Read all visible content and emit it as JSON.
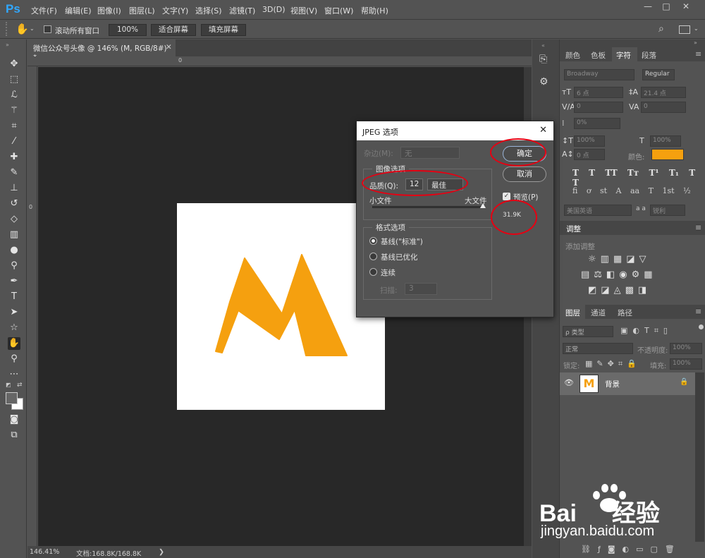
{
  "app": {
    "logo": "Ps"
  },
  "menu": [
    "文件(F)",
    "编辑(E)",
    "图像(I)",
    "图层(L)",
    "文字(Y)",
    "选择(S)",
    "滤镜(T)",
    "3D(D)",
    "视图(V)",
    "窗口(W)",
    "帮助(H)"
  ],
  "window_controls": {
    "minimize": "—",
    "maximize": "□",
    "close": "✕"
  },
  "options_bar": {
    "scroll_all_label": "滚动所有窗口",
    "zoom_btn": "100%",
    "fit_btn": "适合屏幕",
    "fill_btn": "填充屏幕"
  },
  "document_tab": {
    "title": "微信公众号头像 @ 146% (M, RGB/8#) *",
    "close": "✕"
  },
  "rulers": {
    "top_zero": "0",
    "left_zero": "0"
  },
  "status": {
    "zoom": "146.41%",
    "doc": "文档:168.8K/168.8K",
    "arrow": "❯"
  },
  "logo_colors": {
    "accent": "#f5a00f"
  },
  "dialog": {
    "title": "JPEG 选项",
    "close": "✕",
    "matte_label": "杂边(M):",
    "matte_value": "无",
    "image_options": "图像选项",
    "quality_label": "品质(Q):",
    "quality_value": "12",
    "quality_preset": "最佳",
    "small_file": "小文件",
    "large_file": "大文件",
    "format_options": "格式选项",
    "baseline_standard": "基线(\"标准\")",
    "baseline_optimized": "基线已优化",
    "progressive": "连续",
    "scans_label": "扫描:",
    "scans_value": "3",
    "ok": "确定",
    "cancel": "取消",
    "preview_label": "预览(P)",
    "file_size": "31.9K"
  },
  "char_panel": {
    "tabs": [
      "颜色",
      "色板",
      "字符",
      "段落"
    ],
    "active_tab": "字符",
    "font_family": "Broadway",
    "font_style": "Regular",
    "font_size": "6 点",
    "leading": "21.4 点",
    "kerning": "0",
    "tracking": "0",
    "scale_pct": "0%",
    "v_scale": "100%",
    "h_scale": "100%",
    "baseline": "0 点",
    "color_label": "颜色:",
    "type_styles": [
      "T",
      "T",
      "TT",
      "Tт",
      "T¹",
      "T₁",
      "T",
      "T"
    ],
    "opentype": [
      "fi",
      "ơ",
      "st",
      "A",
      "aa",
      "T",
      "1st",
      "½"
    ],
    "language": "美国英语",
    "aa_label": "a a",
    "aa_value": "锐利"
  },
  "adjust_panel": {
    "title": "调整",
    "subtitle": "添加调整"
  },
  "layers_panel": {
    "tabs": [
      "图层",
      "通道",
      "路径"
    ],
    "filter": "ρ 类型",
    "blend_mode": "正常",
    "opacity_label": "不透明度:",
    "opacity_value": "100%",
    "lock_label": "锁定:",
    "fill_label": "填充:",
    "fill_value": "100%",
    "layer_name": "背景"
  },
  "watermark": {
    "brand": "Bai",
    "brand_cn": "经验",
    "url": "jingyan.baidu.com"
  }
}
